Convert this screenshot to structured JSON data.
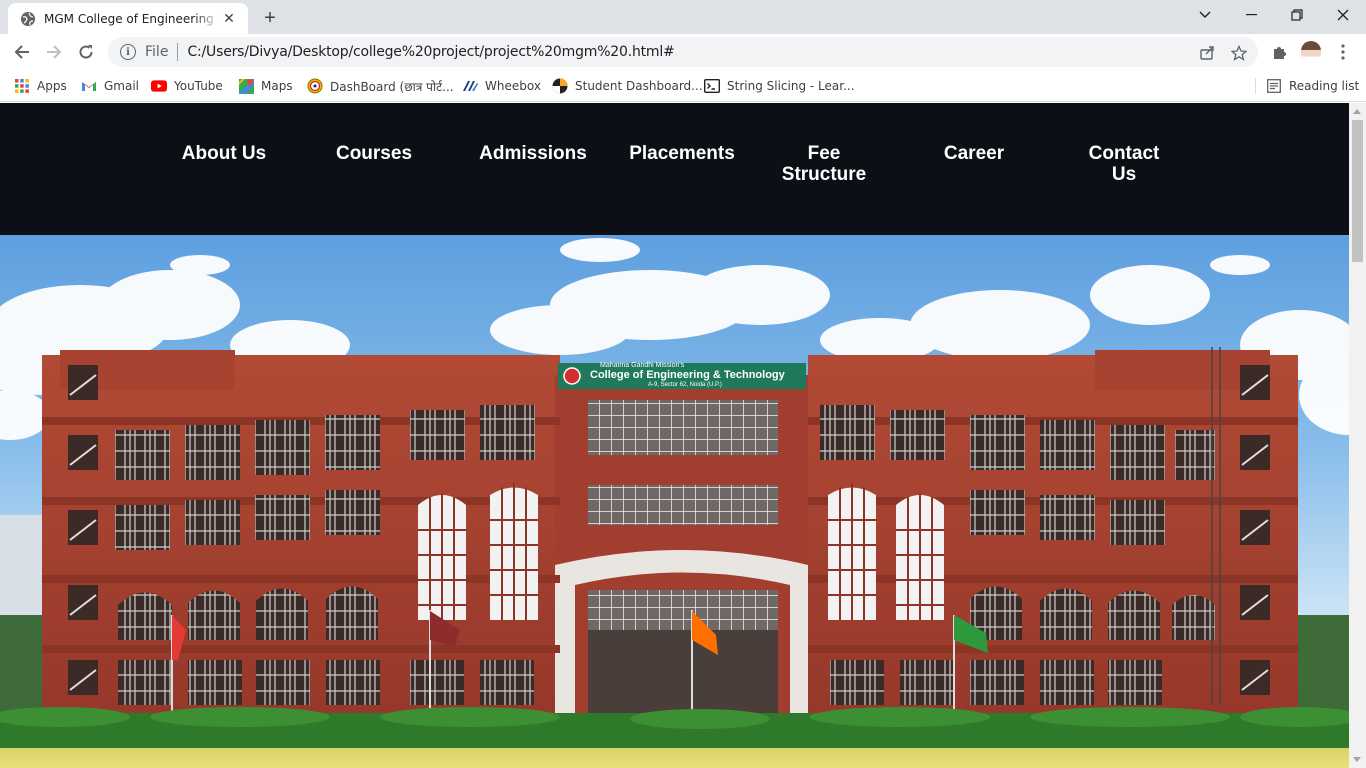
{
  "browser": {
    "tab": {
      "title": "MGM College of Engineering & Technology",
      "close_icon": "close-icon",
      "favicon": "globe-icon"
    },
    "new_tab_label": "+",
    "window_controls": [
      "minimize-icon",
      "restore-icon",
      "close-icon"
    ],
    "omnibox": {
      "scheme_label": "File",
      "url": "C:/Users/Divya/Desktop/college%20project/project%20mgm%20.html#"
    },
    "bookmarks": [
      {
        "label": "Apps",
        "icon": "apps-grid-icon"
      },
      {
        "label": "Gmail",
        "icon": "gmail-icon"
      },
      {
        "label": "YouTube",
        "icon": "youtube-icon"
      },
      {
        "label": "Maps",
        "icon": "maps-icon"
      },
      {
        "label": "DashBoard (छात्र पोर्ट...",
        "icon": "portal-icon"
      },
      {
        "label": "Wheebox",
        "icon": "wheebox-icon"
      },
      {
        "label": "Student Dashboard...",
        "icon": "student-dashboard-icon"
      },
      {
        "label": "String Slicing - Lear...",
        "icon": "terminal-icon"
      }
    ],
    "reading_list_label": "Reading list",
    "colors": {
      "tabstrip": "#dee1e6",
      "omnibox": "#f1f3f4"
    }
  },
  "site": {
    "nav": [
      {
        "label": "About Us"
      },
      {
        "label": "Courses"
      },
      {
        "label": "Admissions"
      },
      {
        "label": "Placements"
      },
      {
        "label": "Fee Structure"
      },
      {
        "label": "Career"
      },
      {
        "label": "Contact Us"
      }
    ],
    "hero": {
      "sign_top": "Mahatma Gandhi Mission's",
      "sign_main": "College of Engineering & Technology",
      "sign_sub": "A-9, Sector 62, Noida (U.P.)"
    },
    "colors": {
      "nav_bg": "#0d0f17",
      "nav_text": "#ffffff",
      "brick": "#a8402f",
      "sign": "#1f7a5c"
    }
  }
}
